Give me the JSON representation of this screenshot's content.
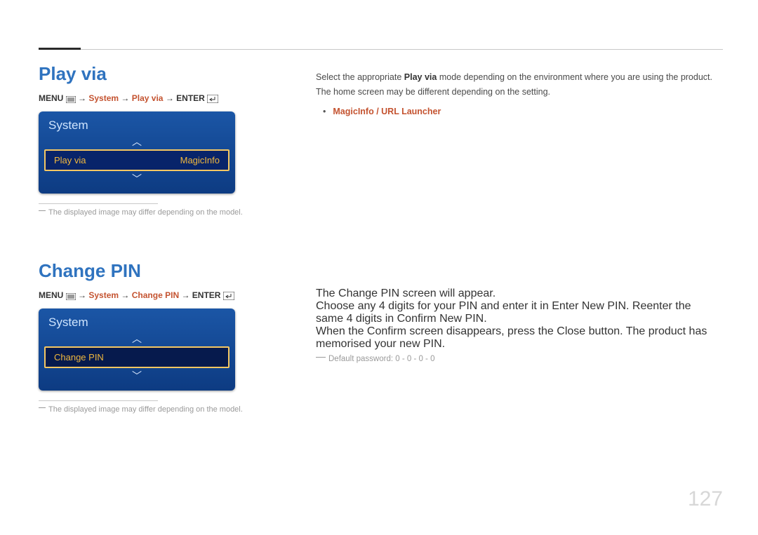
{
  "page_number": "127",
  "section1": {
    "title": "Play via",
    "breadcrumb": {
      "prefix": "MENU",
      "arrow": "→",
      "sys": "System",
      "item": "Play via",
      "enter": "ENTER"
    },
    "osd": {
      "header": "System",
      "row_label": "Play via",
      "row_value": "MagicInfo"
    },
    "note": "The displayed image may differ depending on the model.",
    "right": {
      "p1a": "Select the appropriate ",
      "p1b": "Play via",
      "p1c": " mode depending on the environment where you are using the product.",
      "p2": "The home screen may be different depending on the setting.",
      "bullet1": "MagicInfo / URL Launcher"
    }
  },
  "section2": {
    "title": "Change PIN",
    "breadcrumb": {
      "prefix": "MENU",
      "arrow": "→",
      "sys": "System",
      "item": "Change PIN",
      "enter": "ENTER"
    },
    "osd": {
      "header": "System",
      "row_label": "Change PIN"
    },
    "note": "The displayed image may differ depending on the model.",
    "right": {
      "p1a": "The ",
      "p1b": "Change PIN",
      "p1c": " screen will appear.",
      "p2a": "Choose any 4 digits for your PIN and enter it in ",
      "p2b": "Enter New PIN",
      "p2c": ". Reenter the same 4 digits in ",
      "p2d": "Confirm New PIN",
      "p2e": ".",
      "p3a": "When the Confirm screen disappears, press the ",
      "p3b": "Close",
      "p3c": " button. The product has memorised your new PIN.",
      "note": "Default password: 0 - 0 - 0 - 0"
    }
  }
}
